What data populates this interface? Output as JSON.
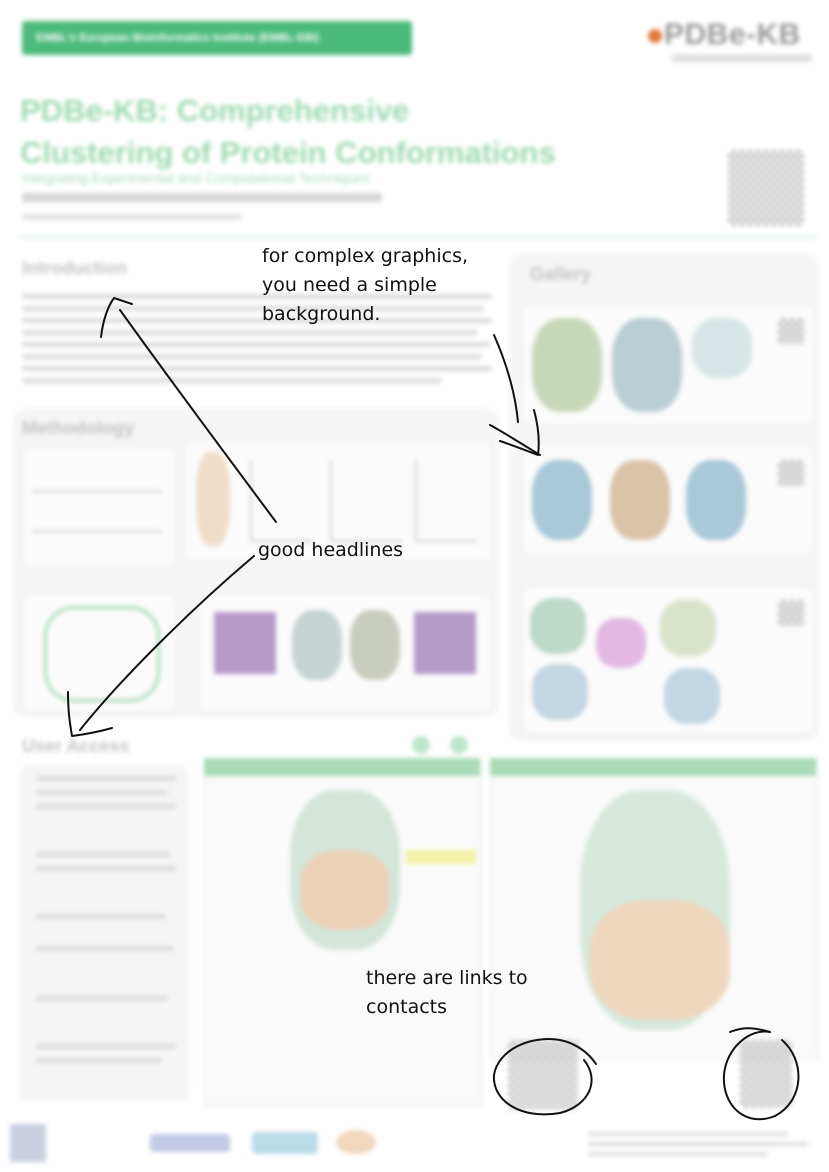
{
  "poster": {
    "banner_text": "EMBL's European Bioinformatics Institute (EMBL-EBI)",
    "logo_text": "PDBe-KB",
    "title_line1": "PDBe-KB: Comprehensive",
    "title_line2": "Clustering of Protein Conformations",
    "subtitle": "Integrating Experimental and Computational Techniques",
    "section_introduction": "Introduction",
    "section_methodology": "Methodology",
    "section_gallery": "Gallery",
    "section_user_access": "User Access"
  },
  "annotations": {
    "note_graphics_line1": "for complex graphics,",
    "note_graphics_line2": "you need a simple",
    "note_graphics_line3": "background.",
    "note_headlines": "good headlines",
    "note_links_line1": "there are links to",
    "note_links_line2": "contacts"
  },
  "colors": {
    "accent_green": "#4cba7a",
    "ink": "#111111"
  }
}
